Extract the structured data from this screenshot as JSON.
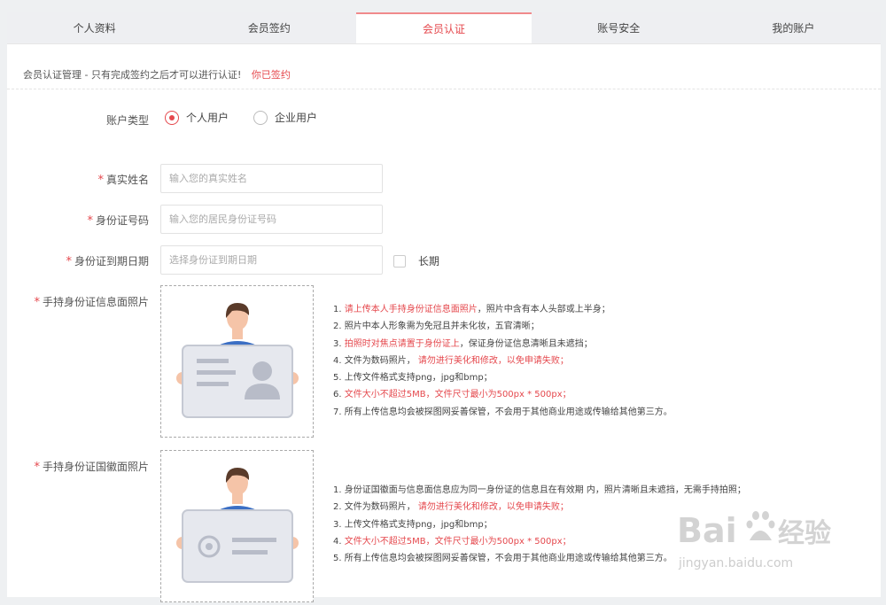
{
  "tabs": [
    "个人资料",
    "会员签约",
    "会员认证",
    "账号安全",
    "我的账户"
  ],
  "active_tab": "会员认证",
  "notice": {
    "text": "会员认证管理 - 只有完成签约之后才可以进行认证!",
    "link": "你已签约"
  },
  "account_type": {
    "label": "账户类型",
    "options": [
      "个人用户",
      "企业用户"
    ],
    "selected": "个人用户"
  },
  "fields": {
    "real_name": {
      "label": "真实姓名",
      "placeholder": "输入您的真实姓名"
    },
    "id_number": {
      "label": "身份证号码",
      "placeholder": "输入您的居民身份证号码"
    },
    "id_expiry": {
      "label": "身份证到期日期",
      "placeholder": "选择身份证到期日期"
    }
  },
  "long_term_label": "长期",
  "upload_front": {
    "label": "手持身份证信息面照片",
    "tips": [
      {
        "num": "1. ",
        "red": "请上传本人手持身份证信息面照片",
        "text": "，照片中含有本人头部或上半身；"
      },
      {
        "num": "2. ",
        "red": "",
        "text": "照片中本人形象需为免冠且并未化妆，五官清晰；"
      },
      {
        "num": "3. ",
        "red": "拍照时对焦点请置于身份证上",
        "text": "，保证身份证信息清晰且未遮挡；"
      },
      {
        "num": "4. ",
        "pre": "文件为数码照片，",
        "red": "请勿进行美化和修改，以免申请失败；",
        "text": ""
      },
      {
        "num": "5. ",
        "red": "",
        "text": "上传文件格式支持png，jpg和bmp；"
      },
      {
        "num": "6. ",
        "red": "文件大小不超过5MB，文件尺寸最小为500px * 500px；",
        "text": ""
      },
      {
        "num": "7. ",
        "red": "",
        "text": "所有上传信息均会被探图网妥善保管，不会用于其他商业用途或传输给其他第三方。"
      }
    ]
  },
  "upload_back": {
    "label": "手持身份证国徽面照片",
    "tips": [
      {
        "num": "1. ",
        "red": "",
        "text": "身份证国徽面与信息面信息应为同一身份证的信息且在有效期 内，照片清晰且未遮挡，无需手持拍照；"
      },
      {
        "num": "2. ",
        "pre": "文件为数码照片，",
        "red": "请勿进行美化和修改，以免申请失败；",
        "text": ""
      },
      {
        "num": "3. ",
        "red": "",
        "text": "上传文件格式支持png，jpg和bmp；"
      },
      {
        "num": "4. ",
        "red": "文件大小不超过5MB，文件尺寸最小为500px * 500px；",
        "text": ""
      },
      {
        "num": "5. ",
        "red": "",
        "text": "所有上传信息均会被探图网妥善保管，不会用于其他商业用途或传输给其他第三方。"
      }
    ]
  },
  "watermark": {
    "brand": "Bai",
    "brand2": "经验",
    "url": "jingyan.baidu.com"
  },
  "colors": {
    "accent": "#e5484d",
    "tab_bg": "#eeeff2",
    "illustration_card": "#e8eaf0"
  }
}
